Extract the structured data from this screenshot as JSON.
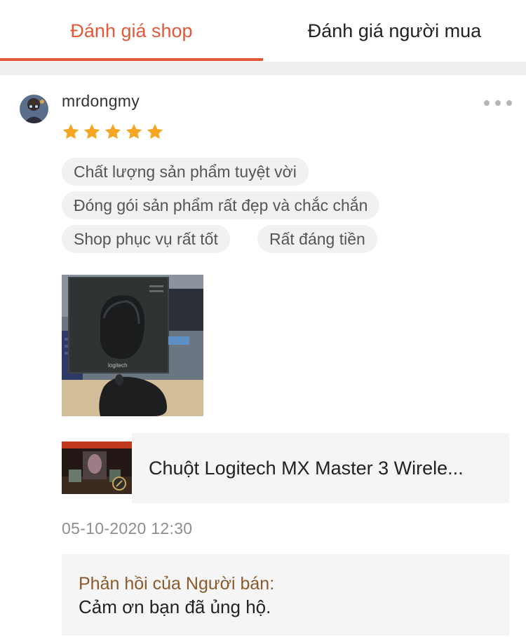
{
  "tabs": [
    {
      "label": "Đánh giá shop",
      "active": true
    },
    {
      "label": "Đánh giá người mua",
      "active": false
    }
  ],
  "colors": {
    "accent": "#e4583a",
    "star": "#f5a623",
    "seller_label": "#8b5a2b",
    "tag_bg": "#f1f1f1"
  },
  "review": {
    "username": "mrdongmy",
    "rating": 5,
    "rating_max": 5,
    "tags": [
      "Chất lượng sản phẩm tuyệt vời",
      "Đóng gói sản phẩm rất đẹp và chắc chắn",
      "Shop phục vụ rất tốt",
      "Rất đáng tiền"
    ],
    "photo_icon": "mouse-box-photo",
    "product": {
      "name": "Chuột Logitech MX Master 3 Wirele..."
    },
    "timestamp": "05-10-2020 12:30",
    "seller_reply": {
      "label": "Phản hồi của Người bán:",
      "text": "Cảm ơn bạn đã ủng hộ."
    }
  }
}
